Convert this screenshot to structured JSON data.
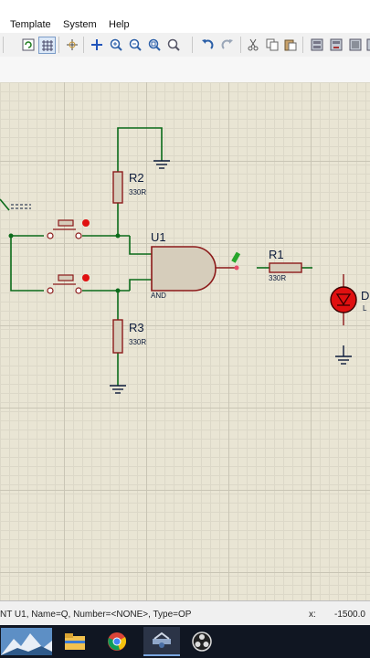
{
  "menu": {
    "items": [
      "Template",
      "System",
      "Help"
    ]
  },
  "toolbar": {
    "icons": [
      "grid-icon",
      "origin-icon",
      "pan-icon",
      "zoom-in-icon",
      "zoom-out-icon",
      "zoom-all-icon",
      "zoom-area-icon",
      "undo-icon",
      "redo-icon",
      "cut-icon",
      "copy-icon",
      "paste-icon",
      "block-copy-icon",
      "block-move-icon",
      "block-rotate-icon"
    ]
  },
  "schematic": {
    "components": {
      "r2": {
        "ref": "R2",
        "value": "330R"
      },
      "r3": {
        "ref": "R3",
        "value": "330R"
      },
      "r1": {
        "ref": "R1",
        "value": "330R"
      },
      "u1": {
        "ref": "U1",
        "type": "AND"
      },
      "led": {
        "ref": "D",
        "value": "L"
      }
    }
  },
  "status": {
    "message": "NT U1, Name=Q, Number=<NONE>, Type=OP",
    "x_label": "x:",
    "x_value": "-1500.0"
  },
  "taskbar": {
    "apps": [
      "start-landscape-icon",
      "file-explorer-icon",
      "chrome-icon",
      "proteus-isis-icon",
      "obs-icon"
    ]
  },
  "colors": {
    "canvas_bg": "#e9e5d4",
    "wire": "#0b6b1a",
    "component": "#8c1a1a",
    "component_fill": "#d6cdbb",
    "led_red": "#e01010"
  }
}
